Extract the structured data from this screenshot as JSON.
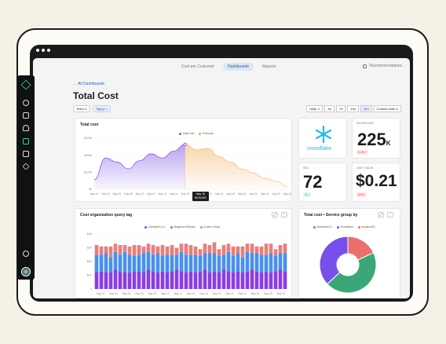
{
  "nav": {
    "tabs": [
      "Cost per Customer",
      "Dashboards",
      "Reports"
    ],
    "active_tab": 1,
    "recommendations": "Recommendations"
  },
  "page": {
    "breadcrumb": "← All Dashboards",
    "title": "Total Cost",
    "filter_team": "Team ∨",
    "filter_tag": "Tagbyl ×",
    "granularity": "Daily ∨",
    "ranges": [
      "3d",
      "7d",
      "14d",
      "30d"
    ],
    "active_range": 3,
    "custom_date": "Custom Date ∨"
  },
  "total_cost": {
    "title": "Total cost",
    "legend": [
      "Total cost",
      "Forecast"
    ],
    "tooltip_date": "May 18",
    "tooltip_value": "$225,892"
  },
  "kpis": {
    "snowflake_logo_text": "snowflake",
    "snowflake_label": "SNOWFLAKE",
    "snowflake_value": "225",
    "snowflake_suffix": "K",
    "snowflake_delta": "2.1% ↑",
    "rds_label": "RDS",
    "rds_value": "72",
    "rds_delta": "11 ↓",
    "unit_label": "UNIT / HOUR",
    "unit_value": "$0.21",
    "unit_delta": "11% ↑"
  },
  "org_cost": {
    "title": "Cost organization query tag",
    "legend": [
      "Campbell LLC",
      "Singleton-Rhodes",
      "Evans Group"
    ]
  },
  "service_cost": {
    "title": "Total cost • Service group by",
    "legend": [
      "AmazonEC2",
      "Snowflake",
      "AmazonS3"
    ]
  },
  "colors": {
    "purple": "#8158e6",
    "orange": "#f3a345",
    "bar_purple": "#8a3ee0",
    "bar_blue": "#4a90e8",
    "bar_red": "#e77f7f",
    "pie_green": "#3aa876",
    "pie_purple": "#7650e8",
    "pie_red": "#ea6f6f",
    "accent_blue": "#2d63b4",
    "sidebar_green": "#3fd08f"
  },
  "chart_data": [
    {
      "type": "area",
      "title": "Total cost",
      "x": [
        "May 02",
        "May 04",
        "May 06",
        "May 08",
        "May 10",
        "May 12",
        "May 14",
        "May 16",
        "May 18",
        "May 20",
        "May 22",
        "May 24",
        "May 26",
        "May 28",
        "May 30",
        "May 01",
        "May 03",
        "May 05"
      ],
      "ylim": [
        0,
        375
      ],
      "yticks": [
        "$0",
        "$125K",
        "$250K",
        "$375K"
      ],
      "series": [
        {
          "name": "Total cost",
          "values": [
            70,
            230,
            200,
            150,
            210,
            260,
            230,
            280,
            330,
            null,
            null,
            null,
            null,
            null,
            null,
            null,
            null,
            null
          ]
        },
        {
          "name": "Forecast",
          "values": [
            null,
            null,
            null,
            null,
            null,
            null,
            null,
            null,
            330,
            290,
            300,
            240,
            200,
            150,
            120,
            80,
            60,
            20
          ]
        }
      ]
    },
    {
      "type": "bar",
      "title": "Cost organization query tag",
      "x": [
        "May 02",
        "May 04",
        "May 06",
        "May 08",
        "May 10",
        "May 12",
        "May 14",
        "May 16",
        "May 18",
        "May 20",
        "May 22",
        "May 24",
        "May 26",
        "May 28",
        "May 30"
      ],
      "ylim": [
        0,
        4
      ],
      "yticks": [
        "0",
        "$1K",
        "$2K",
        "$3K",
        "$4K"
      ],
      "series": [
        {
          "name": "Campbell LLC",
          "values": [
            1.2,
            1.3,
            1.2,
            1.2,
            1.4,
            1.3,
            1.2,
            1.2,
            1.3,
            1.3,
            1.2,
            1.4,
            1.3,
            1.2,
            1.3,
            1.2,
            1.3,
            1.4,
            1.3,
            1.2,
            1.3,
            1.2,
            1.3,
            1.4,
            1.2,
            1.3,
            1.2,
            1.4,
            1.3,
            1.2,
            1.3,
            1.2,
            1.3,
            1.4,
            1.3,
            1.2,
            1.3,
            1.2,
            1.3,
            1.4,
            1.3
          ]
        },
        {
          "name": "Singleton-Rhodes",
          "values": [
            1.3,
            1.2,
            1.4,
            1.1,
            1.3,
            1.2,
            1.5,
            1.3,
            1.1,
            1.2,
            1.4,
            1.3,
            1.2,
            1.4,
            1.1,
            1.3,
            1.2,
            1.1,
            1.4,
            1.3,
            1.2,
            1.3,
            1.1,
            1.2,
            1.4,
            1.3,
            1.2,
            1.1,
            1.4,
            1.2,
            1.3,
            1.1,
            1.4,
            1.2,
            1.3,
            1.3,
            1.2,
            1.4,
            1.1,
            1.2,
            1.3
          ]
        },
        {
          "name": "Evans Group",
          "values": [
            0.7,
            0.6,
            0.5,
            0.8,
            0.6,
            0.7,
            0.5,
            0.6,
            0.8,
            0.7,
            0.5,
            0.6,
            0.7,
            0.5,
            0.8,
            0.6,
            0.7,
            0.5,
            0.6,
            0.8,
            0.7,
            0.6,
            0.5,
            0.7,
            0.6,
            0.8,
            0.5,
            0.7,
            0.6,
            0.7,
            0.5,
            0.8,
            0.6,
            0.7,
            0.5,
            0.6,
            0.8,
            0.7,
            0.5,
            0.6,
            0.7
          ]
        }
      ]
    },
    {
      "type": "pie",
      "title": "Total cost • Service group by",
      "categories": [
        "AmazonEC2",
        "Snowflake",
        "AmazonS3"
      ],
      "values": [
        45,
        37,
        18
      ]
    }
  ]
}
